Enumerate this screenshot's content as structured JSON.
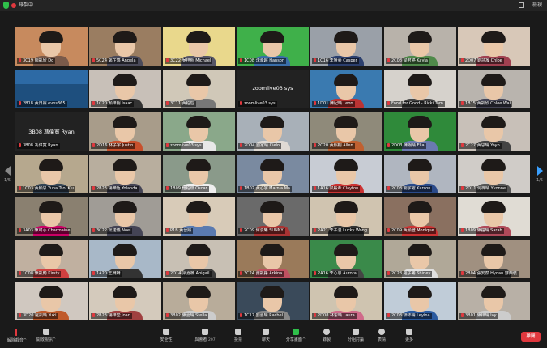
{
  "topbar": {
    "recording_label": "錄製中",
    "view_label": "檢視"
  },
  "pager": {
    "left": "1/5",
    "right": "1/5"
  },
  "tiles": [
    {
      "name": "3C19 關凱欣 Do",
      "bg": "#c78a5e",
      "body": "#7a5a4a"
    },
    {
      "name": "5C24 鄭芷悠 Angela",
      "bg": "#9a7d61",
      "body": "#4a4a5a"
    },
    {
      "name": "3C22 吳梓熙 Michael",
      "bg": "#e9d88c",
      "body": "#556"
    },
    {
      "name": "1C08 沈幸超 Hanson",
      "bg": "#3fb04a",
      "body": "#3a6ea8"
    },
    {
      "name": "1C16 李賢豪 Casper",
      "bg": "#9aa0a8",
      "body": "#2b3f6e"
    },
    {
      "name": "2C08 梁君婷 Kayla",
      "bg": "#b8b2aa",
      "body": "#4f8a4a"
    },
    {
      "name": "2D07 劉詩凝 Chloe",
      "bg": "#d8c8b8",
      "body": "#a04050"
    },
    {
      "name": "2B18 黃日霖 evns365",
      "bg": "#2d6aa5",
      "body": "#2d6aa5",
      "scenic": true
    },
    {
      "name": "1C20 顏梓朗 Isaac",
      "bg": "#c8c0b8",
      "body": "#333"
    },
    {
      "name": "3C11 黃柏愷",
      "bg": "#d0c8b8",
      "body": "#777"
    },
    {
      "name": "zoomlive03 sys",
      "bg": "#222",
      "text": "zoomlive03 sys",
      "textonly": true
    },
    {
      "name": "1D01 陳紀晴 Leon",
      "bg": "#3a7ab0",
      "body": "#b33"
    },
    {
      "name": "Food for Good - Ricki Tam",
      "bg": "#d6d2cc",
      "body": "#444"
    },
    {
      "name": "1B15 黃凱欣 Chloe Wai",
      "bg": "#b9b4ae",
      "body": "#445"
    },
    {
      "name": "3B08 馮偉寬 Ryan",
      "bg": "#222",
      "text": "3B08 馮偉寬 Ryan",
      "textonly": true
    },
    {
      "name": "2D16 林子宇 Justin",
      "bg": "#a89c8a",
      "body": "#c8502c"
    },
    {
      "name": "zoomlive03 sys",
      "bg": "#8aa88a",
      "body": "#e8e8e8",
      "speaking": true
    },
    {
      "name": "2D04 劉家晴 Cielo",
      "bg": "#a8b0b8",
      "body": "#e0dad4"
    },
    {
      "name": "2C20 黃熙桐 Allen",
      "bg": "#8f8a7a",
      "body": "#c06030"
    },
    {
      "name": "2D03 陳朗晴 Ella",
      "bg": "#2f8a3a",
      "body": "#6a7ab0"
    },
    {
      "name": "2C27 黃思晴 Yoyo",
      "bg": "#c8c0b8",
      "body": "#444"
    },
    {
      "name": "1C03 黃穎思 Yuna Tsoi Kiu",
      "bg": "#b6a88e",
      "body": "#345"
    },
    {
      "name": "2B23 楊樂恆 Yolanda",
      "bg": "#b8ae9e",
      "body": "#445"
    },
    {
      "name": "1B09 鍾柏燃 Oscar",
      "bg": "#8a9a8a",
      "body": "#eee"
    },
    {
      "name": "1B02 黃心宇 Marnia Ma",
      "bg": "#7a8aa0",
      "body": "#e8e0d0"
    },
    {
      "name": "1A16 梁殷希 Clayton",
      "bg": "#c8ccd4",
      "body": "#c33"
    },
    {
      "name": "2C08 關宇曜 Karson",
      "bg": "#b0b6c0",
      "body": "#2a4a8a"
    },
    {
      "name": "2D11 何梓晴 Yvonne",
      "bg": "#d0ccc8",
      "body": "#555"
    },
    {
      "name": "3A03 陳可心 Charmaine",
      "bg": "#8a8070",
      "body": "#c06"
    },
    {
      "name": "3C22 葉諾儀 Noel",
      "bg": "#a09c96",
      "body": "#445"
    },
    {
      "name": "P1B 黃晉熙",
      "bg": "#d8cbb8",
      "body": "#5a7ab0"
    },
    {
      "name": "2C09 何浚晞 SUNNY",
      "bg": "#6a6a6a",
      "body": "#a33"
    },
    {
      "name": "2A21 李子浚 Lucky Wong",
      "bg": "#d0c4b0",
      "body": "#333"
    },
    {
      "name": "2C09 黃穎澄 Monique",
      "bg": "#8a7060",
      "body": "#c33"
    },
    {
      "name": "1B09 陳鎧晴 Sarah",
      "bg": "#e0dcd4",
      "body": "#b04a5a"
    },
    {
      "name": "1C08 陳凱勵 Kirsty",
      "bg": "#c0b0a0",
      "body": "#d04040"
    },
    {
      "name": "1A20 王姍姍",
      "bg": "#a8b8c8",
      "body": "#333"
    },
    {
      "name": "2D14 梁嘉楠 Abigail",
      "bg": "#c8c0b4",
      "body": "#3a3a3a"
    },
    {
      "name": "3C24 謝凱錚 Arkina",
      "bg": "#9a7a5a",
      "body": "#c05060"
    },
    {
      "name": "2A16 李心恩 Aurora",
      "bg": "#3a8a4a",
      "body": "#444"
    },
    {
      "name": "2C28 羅子晞 Shirley",
      "bg": "#b0a898",
      "body": "#e0e0e0"
    },
    {
      "name": "2B04 張安然 Hydan 穿西裝",
      "bg": "#a09080",
      "body": "#333"
    },
    {
      "name": "3D20 羅凱晴 Yuki",
      "bg": "#d0c8c0",
      "body": "#c05a2a"
    },
    {
      "name": "2B23 楊梓瑩 Joan",
      "bg": "#d4cabc",
      "body": "#a04040"
    },
    {
      "name": "3B02 陳嘉晴 Stella",
      "bg": "#b8ac9a",
      "body": "#ccc"
    },
    {
      "name": "1C17 劉嘉晴 Rachel",
      "bg": "#3a4a5a",
      "body": "#888"
    },
    {
      "name": "2D08 林思晴 Laura",
      "bg": "#cfc4b0",
      "body": "#d06a8a"
    },
    {
      "name": "2C08 譚沛晴 Leyina",
      "bg": "#c0ccd8",
      "body": "#2a5aa0"
    },
    {
      "name": "3B01 陳梓晴 Ivy",
      "bg": "#b8b0a6",
      "body": "#ccc"
    }
  ],
  "toolbar": {
    "mute_label": "解除靜音",
    "video_label": "開啟視訊",
    "security_label": "安全性",
    "participants_label": "與會者",
    "participants_count": "207",
    "polls_label": "投票",
    "chat_label": "聊天",
    "share_label": "分享畫面",
    "record_label": "錄製",
    "breakout_label": "分組討論",
    "reactions_label": "表情",
    "more_label": "更多",
    "leave_label": "離開"
  },
  "colors": {
    "accent": "#3aa0ff",
    "leave": "#e0383e",
    "share": "#2fbf4a",
    "speaking": "#f7e04b"
  }
}
